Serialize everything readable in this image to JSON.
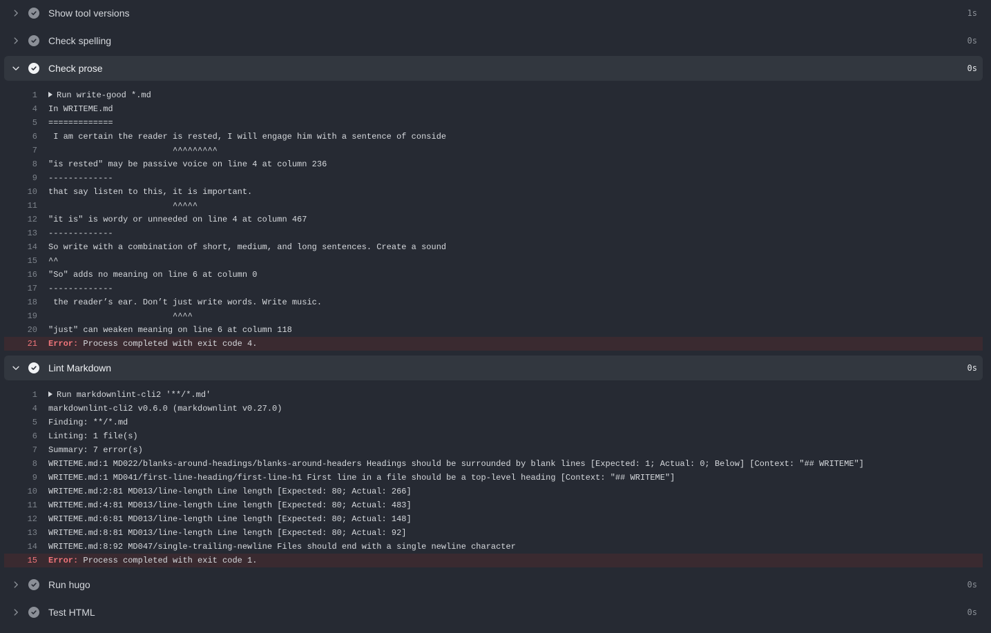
{
  "colors": {
    "background": "#262a33",
    "expanded_header": "#32373f",
    "error_row": "#3a2a30",
    "error_text": "#f0757a",
    "success_icon_muted": "#8b8f97"
  },
  "steps": [
    {
      "title": "Show tool versions",
      "duration": "1s",
      "state": "collapsed",
      "status": "success",
      "chevron_icon": "chevron-right-icon",
      "status_icon": "check-circle-icon"
    },
    {
      "title": "Check spelling",
      "duration": "0s",
      "state": "collapsed",
      "status": "success",
      "chevron_icon": "chevron-right-icon",
      "status_icon": "check-circle-icon"
    },
    {
      "title": "Check prose",
      "duration": "0s",
      "state": "expanded",
      "status": "success",
      "chevron_icon": "chevron-down-icon",
      "status_icon": "check-circle-icon",
      "log": [
        {
          "n": "1",
          "text": "Run write-good *.md",
          "group": true
        },
        {
          "n": "4",
          "text": "In WRITEME.md"
        },
        {
          "n": "5",
          "text": "============="
        },
        {
          "n": "6",
          "text": " I am certain the reader is rested, I will engage him with a sentence of conside"
        },
        {
          "n": "7",
          "text": "                         ^^^^^^^^^"
        },
        {
          "n": "8",
          "text": "\"is rested\" may be passive voice on line 4 at column 236"
        },
        {
          "n": "9",
          "text": "-------------"
        },
        {
          "n": "10",
          "text": "that say listen to this, it is important."
        },
        {
          "n": "11",
          "text": "                         ^^^^^"
        },
        {
          "n": "12",
          "text": "\"it is\" is wordy or unneeded on line 4 at column 467"
        },
        {
          "n": "13",
          "text": "-------------"
        },
        {
          "n": "14",
          "text": "So write with a combination of short, medium, and long sentences. Create a sound"
        },
        {
          "n": "15",
          "text": "^^"
        },
        {
          "n": "16",
          "text": "\"So\" adds no meaning on line 6 at column 0"
        },
        {
          "n": "17",
          "text": "-------------"
        },
        {
          "n": "18",
          "text": " the reader’s ear. Don’t just write words. Write music."
        },
        {
          "n": "19",
          "text": "                         ^^^^"
        },
        {
          "n": "20",
          "text": "\"just\" can weaken meaning on line 6 at column 118"
        },
        {
          "n": "21",
          "label": "Error:",
          "text": " Process completed with exit code 4.",
          "error": true
        }
      ]
    },
    {
      "title": "Lint Markdown",
      "duration": "0s",
      "state": "expanded",
      "status": "success",
      "chevron_icon": "chevron-down-icon",
      "status_icon": "check-circle-icon",
      "log": [
        {
          "n": "1",
          "text": "Run markdownlint-cli2 '**/*.md'",
          "group": true
        },
        {
          "n": "4",
          "text": "markdownlint-cli2 v0.6.0 (markdownlint v0.27.0)"
        },
        {
          "n": "5",
          "text": "Finding: **/*.md"
        },
        {
          "n": "6",
          "text": "Linting: 1 file(s)"
        },
        {
          "n": "7",
          "text": "Summary: 7 error(s)"
        },
        {
          "n": "8",
          "text": "WRITEME.md:1 MD022/blanks-around-headings/blanks-around-headers Headings should be surrounded by blank lines [Expected: 1; Actual: 0; Below] [Context: \"## WRITEME\"]"
        },
        {
          "n": "9",
          "text": "WRITEME.md:1 MD041/first-line-heading/first-line-h1 First line in a file should be a top-level heading [Context: \"## WRITEME\"]"
        },
        {
          "n": "10",
          "text": "WRITEME.md:2:81 MD013/line-length Line length [Expected: 80; Actual: 266]"
        },
        {
          "n": "11",
          "text": "WRITEME.md:4:81 MD013/line-length Line length [Expected: 80; Actual: 483]"
        },
        {
          "n": "12",
          "text": "WRITEME.md:6:81 MD013/line-length Line length [Expected: 80; Actual: 148]"
        },
        {
          "n": "13",
          "text": "WRITEME.md:8:81 MD013/line-length Line length [Expected: 80; Actual: 92]"
        },
        {
          "n": "14",
          "text": "WRITEME.md:8:92 MD047/single-trailing-newline Files should end with a single newline character"
        },
        {
          "n": "15",
          "label": "Error:",
          "text": " Process completed with exit code 1.",
          "error": true
        }
      ]
    },
    {
      "title": "Run hugo",
      "duration": "0s",
      "state": "collapsed",
      "status": "success",
      "chevron_icon": "chevron-right-icon",
      "status_icon": "check-circle-icon"
    },
    {
      "title": "Test HTML",
      "duration": "0s",
      "state": "collapsed",
      "status": "success",
      "chevron_icon": "chevron-right-icon",
      "status_icon": "check-circle-icon"
    }
  ]
}
